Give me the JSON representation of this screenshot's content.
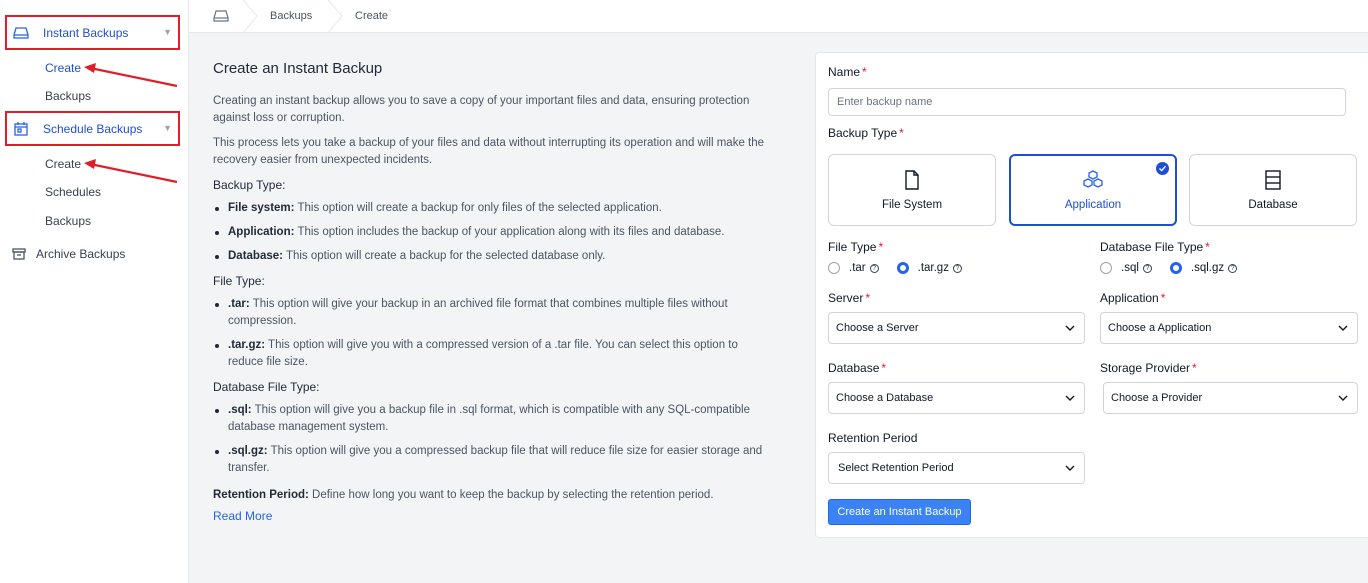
{
  "sidebar": {
    "instant_backups": "Instant Backups",
    "instant_create": "Create",
    "instant_backups_item": "Backups",
    "schedule_backups": "Schedule Backups",
    "schedule_create": "Create",
    "schedule_schedules": "Schedules",
    "schedule_backups_item": "Backups",
    "archive_backups": "Archive Backups"
  },
  "breadcrumb": {
    "home_icon": "hdd-icon",
    "items": [
      "Backups",
      "Create"
    ]
  },
  "info": {
    "title": "Create an Instant Backup",
    "p1": "Creating an instant backup allows you to save a copy of your important files and data, ensuring protection against loss or corruption.",
    "p2": "This process lets you take a backup of your files and data without interrupting its operation and will make the recovery easier from unexpected incidents.",
    "backup_type_heading": "Backup Type:",
    "backup_types": [
      {
        "term": "File system:",
        "desc": " This option will create a backup for only files of the selected application."
      },
      {
        "term": "Application:",
        "desc": " This option includes the backup of your application along with its files and database."
      },
      {
        "term": "Database:",
        "desc": " This option will create a backup for the selected database only."
      }
    ],
    "file_type_heading": "File Type:",
    "file_types": [
      {
        "term": ".tar:",
        "desc": " This option will give your backup in an archived file format that combines multiple files without compression."
      },
      {
        "term": ".tar.gz:",
        "desc": " This option will give you with a compressed version of a .tar file. You can select this option to reduce file size."
      }
    ],
    "db_file_type_heading": "Database File Type:",
    "db_file_types": [
      {
        "term": ".sql:",
        "desc": " This option will give you a backup file in .sql format, which is compatible with any SQL-compatible database management system."
      },
      {
        "term": ".sql.gz:",
        "desc": " This option will give you a compressed backup file that will reduce file size for easier storage and transfer."
      }
    ],
    "retention_term": "Retention Period:",
    "retention_desc": " Define how long you want to keep the backup by selecting the retention period.",
    "read_more": "Read More"
  },
  "form": {
    "name_label": "Name",
    "name_placeholder": "Enter backup name",
    "backup_type_label": "Backup Type",
    "types": [
      "File System",
      "Application",
      "Database"
    ],
    "selected_type": "Application",
    "file_type_label": "File Type",
    "file_type_options": [
      ".tar",
      ".tar.gz"
    ],
    "file_type_selected": ".tar.gz",
    "db_file_type_label": "Database File Type",
    "db_file_type_options": [
      ".sql",
      ".sql.gz"
    ],
    "db_file_type_selected": ".sql.gz",
    "server_label": "Server",
    "server_value": "Choose a Server",
    "application_label": "Application",
    "application_value": "Choose a Application",
    "database_label": "Database",
    "database_value": "Choose a Database",
    "storage_label": "Storage Provider",
    "storage_value": "Choose a Provider",
    "retention_label": "Retention Period",
    "retention_value": "Select Retention Period",
    "submit": "Create an Instant Backup",
    "required_mark": "*"
  },
  "colors": {
    "accent": "#2563eb",
    "highlight_box": "#e11d2a"
  }
}
